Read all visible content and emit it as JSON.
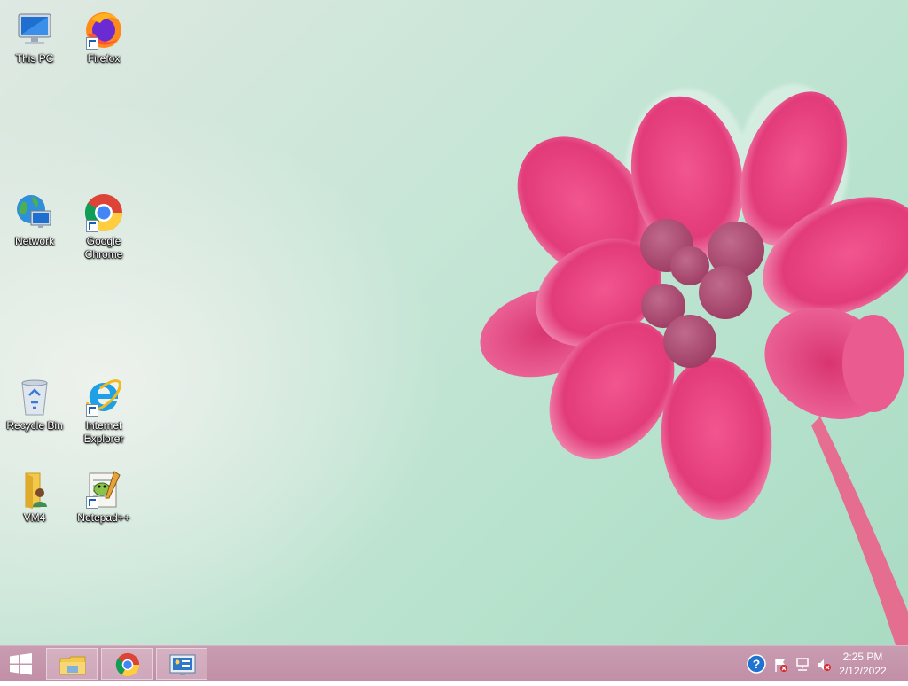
{
  "desktop_icons": [
    {
      "name": "this-pc",
      "label": "This PC",
      "shortcut": false
    },
    {
      "name": "firefox",
      "label": "Firefox",
      "shortcut": true
    },
    {
      "name": "network",
      "label": "Network",
      "shortcut": false
    },
    {
      "name": "google-chrome",
      "label": "Google Chrome",
      "shortcut": true
    },
    {
      "name": "recycle-bin",
      "label": "Recycle Bin",
      "shortcut": false
    },
    {
      "name": "internet-explorer",
      "label": "Internet Explorer",
      "shortcut": true
    },
    {
      "name": "vm4",
      "label": "VM4",
      "shortcut": false
    },
    {
      "name": "notepad-plus-plus",
      "label": "Notepad++",
      "shortcut": true
    }
  ],
  "taskbar": {
    "start_icon": "windows-logo-icon",
    "pinned": [
      {
        "name": "file-explorer",
        "icon": "folder-icon"
      },
      {
        "name": "chrome",
        "icon": "chrome-icon"
      },
      {
        "name": "control-panel",
        "icon": "control-panel-icon"
      }
    ],
    "tray_icons": [
      "help-icon",
      "action-center-flag-icon",
      "network-icon",
      "volume-muted-icon"
    ],
    "clock": {
      "time": "2:25 PM",
      "date": "2/12/2022"
    }
  },
  "colors": {
    "taskbar": "#c593ab",
    "accent": "#e0447f"
  }
}
